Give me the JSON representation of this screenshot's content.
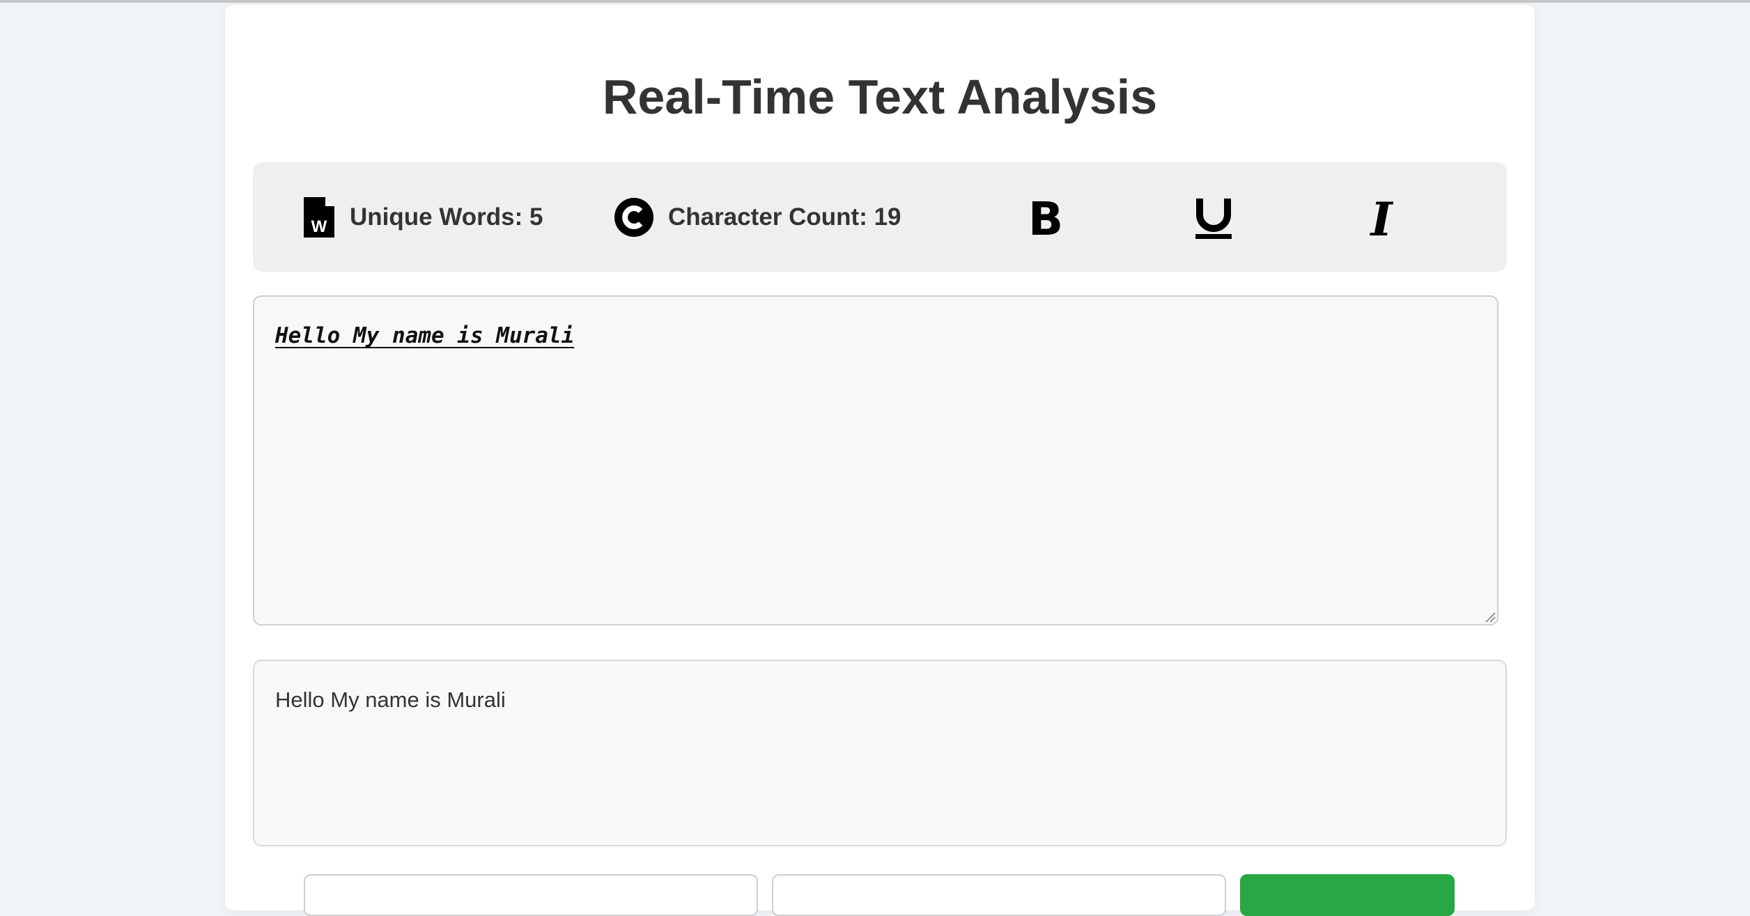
{
  "page": {
    "title": "Real-Time Text Analysis"
  },
  "stats": {
    "unique_words_label": "Unique Words: 5",
    "unique_words_icon": "word-file-icon",
    "character_count_label": "Character Count: 19",
    "character_count_icon": "circle-c-icon"
  },
  "format_buttons": [
    {
      "name": "bold",
      "glyph": "B",
      "icon": "bold-icon"
    },
    {
      "name": "underline",
      "glyph": "U",
      "icon": "underline-icon"
    },
    {
      "name": "italic",
      "glyph": "I",
      "icon": "italic-icon"
    }
  ],
  "editor": {
    "value": "Hello My name is Murali"
  },
  "preview": {
    "text": "Hello My name is Murali"
  },
  "colors": {
    "page_background": "#f2f5f8",
    "card_background": "#ffffff",
    "toolbar_background": "#efefef",
    "text": "#333333",
    "action_green": "#28a745"
  }
}
